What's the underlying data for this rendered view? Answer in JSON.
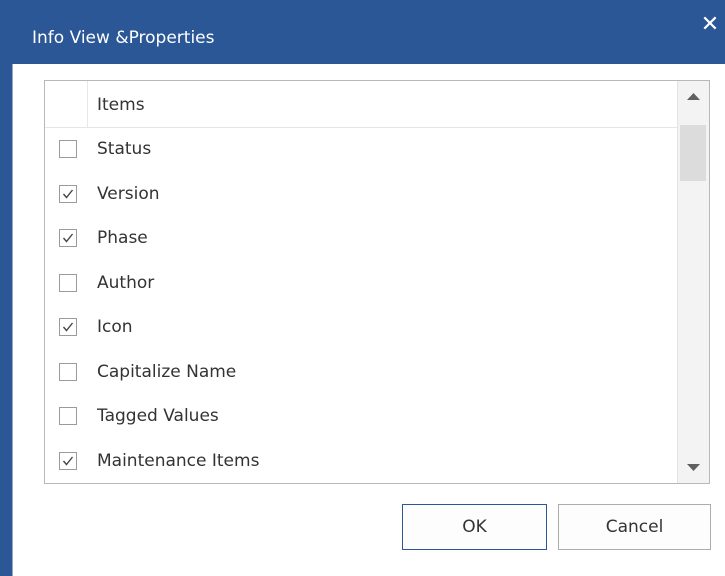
{
  "window": {
    "title": "Info View &Properties",
    "close_glyph": "✕"
  },
  "list": {
    "header": "Items",
    "items": [
      {
        "label": "Status",
        "checked": false
      },
      {
        "label": "Version",
        "checked": true
      },
      {
        "label": "Phase",
        "checked": true
      },
      {
        "label": "Author",
        "checked": false
      },
      {
        "label": "Icon",
        "checked": true
      },
      {
        "label": "Capitalize Name",
        "checked": false
      },
      {
        "label": "Tagged Values",
        "checked": false
      },
      {
        "label": "Maintenance Items",
        "checked": true
      }
    ]
  },
  "buttons": {
    "ok_label": "OK",
    "cancel_label": "Cancel"
  },
  "icons": {
    "scroll_up": "triangle-up-icon",
    "scroll_down": "triangle-down-icon",
    "checkmark": "checkmark-icon"
  },
  "colors": {
    "title_bar": "#2b5797",
    "checkbox_border": "#9b9b9b",
    "text": "#333333"
  }
}
